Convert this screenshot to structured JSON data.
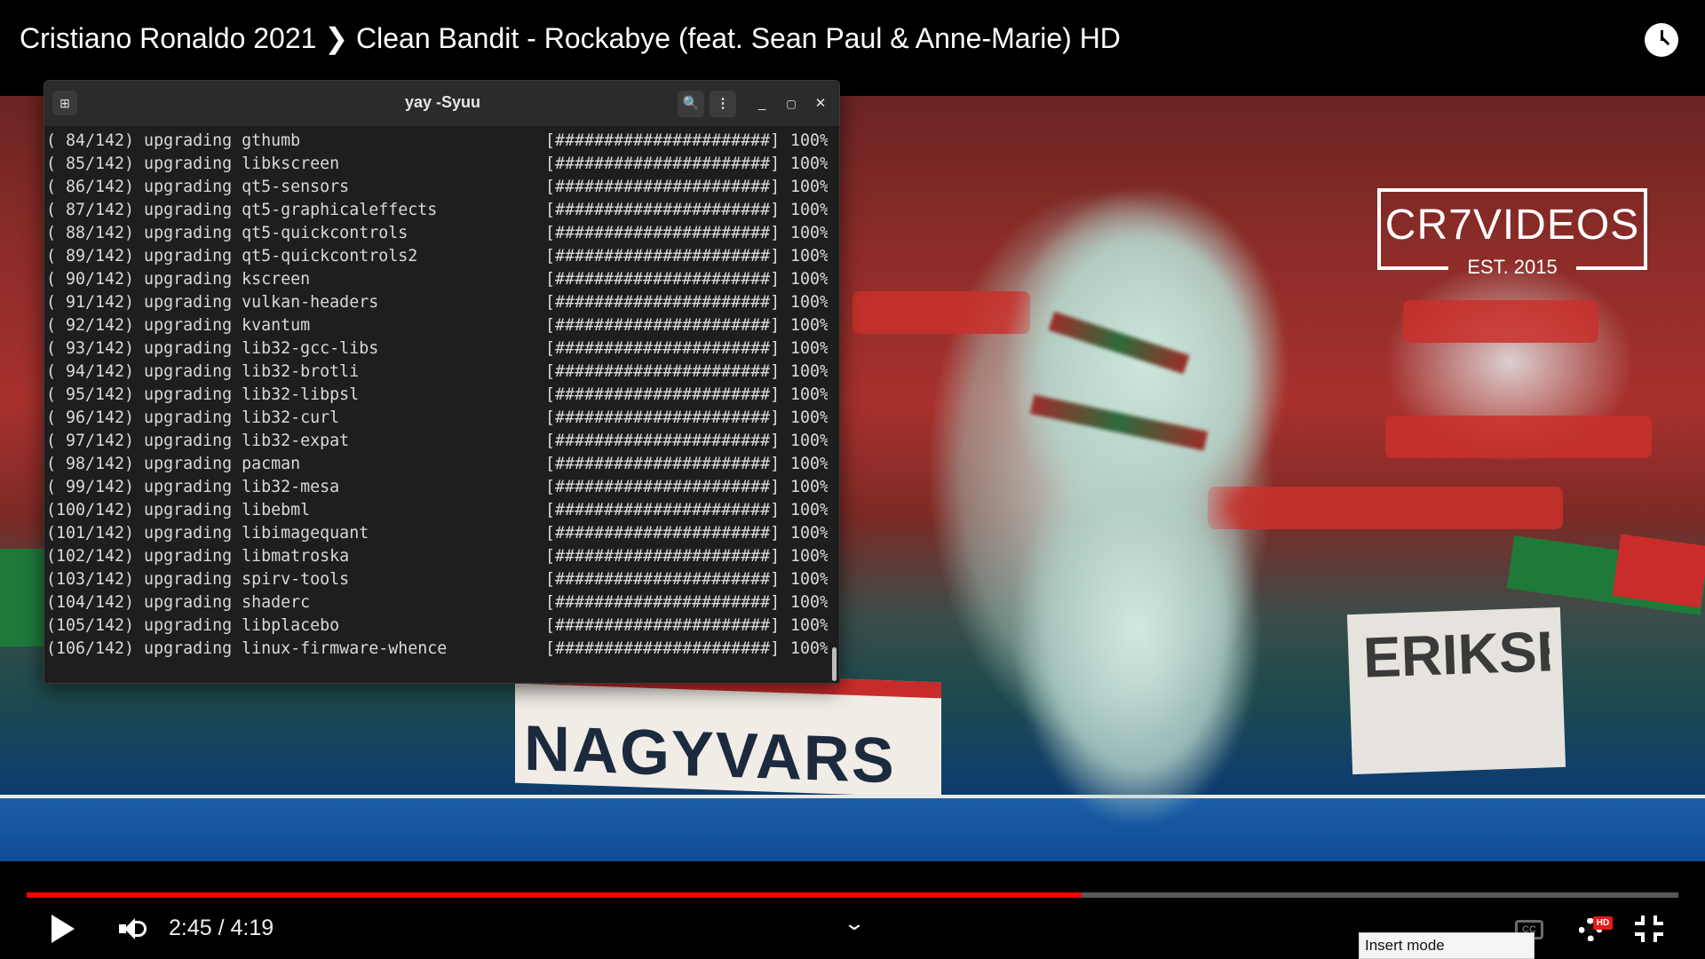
{
  "video": {
    "title": "Cristiano Ronaldo 2021 ❯ Clean Bandit - Rockabye (feat. Sean Paul & Anne-Marie) HD",
    "watermark_title": "CR7VIDEOS",
    "watermark_subtitle": "EST. 2015",
    "banner_text": "NAGYVARS",
    "board_text": "ERIKSE",
    "progress": 0.6386
  },
  "terminal": {
    "title": "yay -Syuu",
    "new_tab_icon": "terminal-icon",
    "search_icon": "🔍",
    "menu_icon": "⋮",
    "minimize_icon": "_",
    "maximize_icon": "▢",
    "close_icon": "✕",
    "bar": "[######################]",
    "lines": [
      {
        "desc": "( 84/142) upgrading gthumb",
        "pct": "100%"
      },
      {
        "desc": "( 85/142) upgrading libkscreen",
        "pct": "100%"
      },
      {
        "desc": "( 86/142) upgrading qt5-sensors",
        "pct": "100%"
      },
      {
        "desc": "( 87/142) upgrading qt5-graphicaleffects",
        "pct": "100%"
      },
      {
        "desc": "( 88/142) upgrading qt5-quickcontrols",
        "pct": "100%"
      },
      {
        "desc": "( 89/142) upgrading qt5-quickcontrols2",
        "pct": "100%"
      },
      {
        "desc": "( 90/142) upgrading kscreen",
        "pct": "100%"
      },
      {
        "desc": "( 91/142) upgrading vulkan-headers",
        "pct": "100%"
      },
      {
        "desc": "( 92/142) upgrading kvantum",
        "pct": "100%"
      },
      {
        "desc": "( 93/142) upgrading lib32-gcc-libs",
        "pct": "100%"
      },
      {
        "desc": "( 94/142) upgrading lib32-brotli",
        "pct": "100%"
      },
      {
        "desc": "( 95/142) upgrading lib32-libpsl",
        "pct": "100%"
      },
      {
        "desc": "( 96/142) upgrading lib32-curl",
        "pct": "100%"
      },
      {
        "desc": "( 97/142) upgrading lib32-expat",
        "pct": "100%"
      },
      {
        "desc": "( 98/142) upgrading pacman",
        "pct": "100%"
      },
      {
        "desc": "( 99/142) upgrading lib32-mesa",
        "pct": "100%"
      },
      {
        "desc": "(100/142) upgrading libebml",
        "pct": "100%"
      },
      {
        "desc": "(101/142) upgrading libimagequant",
        "pct": "100%"
      },
      {
        "desc": "(102/142) upgrading libmatroska",
        "pct": "100%"
      },
      {
        "desc": "(103/142) upgrading spirv-tools",
        "pct": "100%"
      },
      {
        "desc": "(104/142) upgrading shaderc",
        "pct": "100%"
      },
      {
        "desc": "(105/142) upgrading libplacebo",
        "pct": "100%"
      },
      {
        "desc": "(106/142) upgrading linux-firmware-whence",
        "pct": "100%"
      }
    ]
  },
  "controls": {
    "time": "2:45 / 4:19",
    "chevron": "⌄",
    "cc_label": "CC",
    "hd_badge": "HD",
    "insert_mode": "Insert mode"
  },
  "colors": {
    "accent": "#ff0000",
    "terminal_bg": "#1e1e1e",
    "terminal_text": "#d9d9d9"
  }
}
